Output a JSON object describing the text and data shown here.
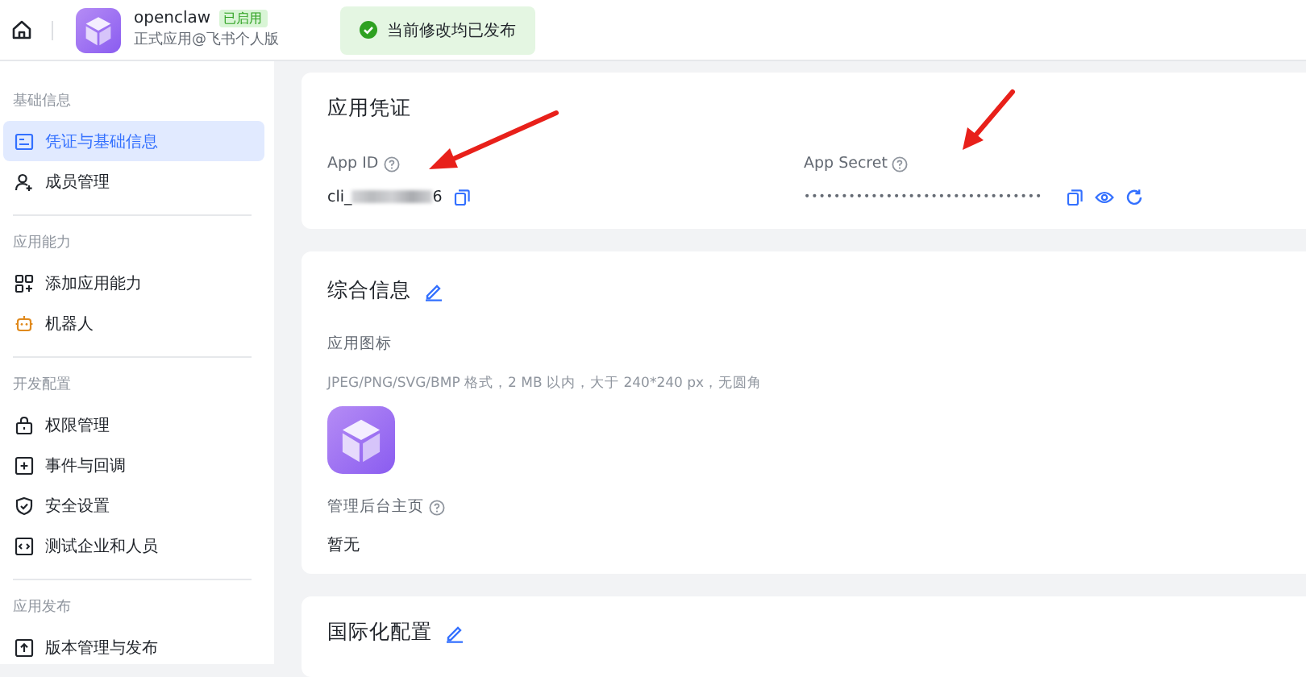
{
  "header": {
    "app_name": "openclaw",
    "status_badge": "已启用",
    "subtitle": "正式应用@飞书个人版",
    "notice": "当前修改均已发布"
  },
  "sidebar": {
    "sections": [
      {
        "title": "基础信息",
        "items": [
          {
            "label": "凭证与基础信息",
            "kind": "card",
            "selected": true
          },
          {
            "label": "成员管理",
            "kind": "member",
            "selected": false
          }
        ]
      },
      {
        "title": "应用能力",
        "items": [
          {
            "label": "添加应用能力",
            "kind": "grid",
            "selected": false
          },
          {
            "label": "机器人",
            "kind": "robot",
            "selected": false
          }
        ]
      },
      {
        "title": "开发配置",
        "items": [
          {
            "label": "权限管理",
            "kind": "lock",
            "selected": false
          },
          {
            "label": "事件与回调",
            "kind": "event",
            "selected": false
          },
          {
            "label": "安全设置",
            "kind": "shield",
            "selected": false
          },
          {
            "label": "测试企业和人员",
            "kind": "code",
            "selected": false
          }
        ]
      },
      {
        "title": "应用发布",
        "items": [
          {
            "label": "版本管理与发布",
            "kind": "upload",
            "selected": false
          }
        ]
      }
    ]
  },
  "credentials": {
    "title": "应用凭证",
    "fields": [
      {
        "label": "App ID",
        "kind": "id",
        "value_prefix": "cli_",
        "value_suffix": "6"
      },
      {
        "label": "App Secret",
        "kind": "secret",
        "value": "••••••••••••••••••••••••••••••••"
      }
    ]
  },
  "general": {
    "title": "综合信息",
    "icon_label": "应用图标",
    "icon_hint": "JPEG/PNG/SVG/BMP 格式，2 MB 以内，大于 240*240 px，无圆角",
    "homepage_label": "管理后台主页",
    "homepage_value": "暂无"
  },
  "i18n": {
    "title": "国际化配置"
  }
}
